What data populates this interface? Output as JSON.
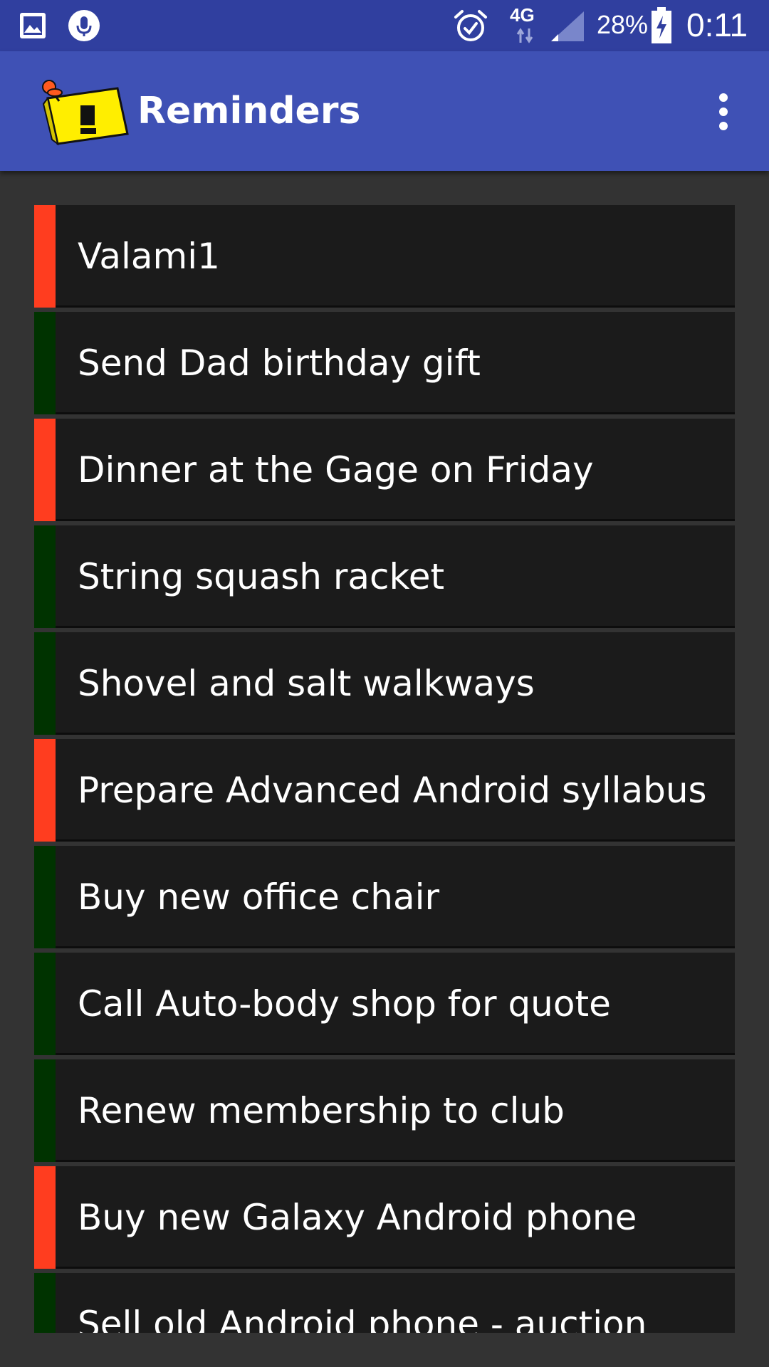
{
  "status_bar": {
    "network": "4G",
    "battery": "28%",
    "time": "0:11",
    "icons": [
      "image-icon",
      "microphone-icon",
      "alarm-icon",
      "signal-icon",
      "battery-charging-icon"
    ]
  },
  "app_bar": {
    "title": "Reminders",
    "logo_icon": "sticky-note-pin-icon",
    "menu_icon": "more-vert-icon"
  },
  "colors": {
    "important": "#FF3D1F",
    "normal": "#003300",
    "app_bar": "#3F51B5",
    "status_bar": "#303F9F"
  },
  "reminders": [
    {
      "text": "Valami1",
      "important": true
    },
    {
      "text": "Send Dad birthday gift",
      "important": false
    },
    {
      "text": "Dinner at the Gage on Friday",
      "important": true
    },
    {
      "text": "String squash racket",
      "important": false
    },
    {
      "text": "Shovel and salt walkways",
      "important": false
    },
    {
      "text": "Prepare Advanced Android syllabus",
      "important": true
    },
    {
      "text": "Buy new office chair",
      "important": false
    },
    {
      "text": "Call Auto-body shop for quote",
      "important": false
    },
    {
      "text": "Renew membership to club",
      "important": false
    },
    {
      "text": "Buy new Galaxy Android phone",
      "important": true
    },
    {
      "text": "Sell old Android phone - auction",
      "important": false
    }
  ]
}
